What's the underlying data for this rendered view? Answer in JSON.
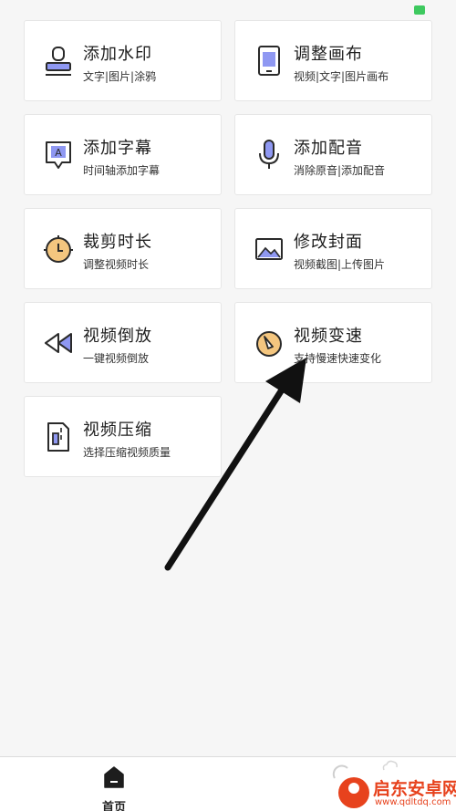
{
  "colors": {
    "accent_orange": "#f4c67f",
    "accent_purple": "#8f98f2",
    "icon_stroke": "#2a2a2a",
    "status_green": "#3ec95f",
    "watermark_red": "#e7421d"
  },
  "tools": [
    {
      "title": "添加水印",
      "subtitle": "文字|图片|涂鸦",
      "icon": "stamp-icon"
    },
    {
      "title": "调整画布",
      "subtitle": "视频|文字|图片画布",
      "icon": "tablet-icon"
    },
    {
      "title": "添加字幕",
      "subtitle": "时间轴添加字幕",
      "icon": "subtitle-icon"
    },
    {
      "title": "添加配音",
      "subtitle": "消除原音|添加配音",
      "icon": "microphone-icon"
    },
    {
      "title": "裁剪时长",
      "subtitle": "调整视频时长",
      "icon": "clock-icon"
    },
    {
      "title": "修改封面",
      "subtitle": "视频截图|上传图片",
      "icon": "image-icon"
    },
    {
      "title": "视频倒放",
      "subtitle": "一键视频倒放",
      "icon": "rewind-icon"
    },
    {
      "title": "视频变速",
      "subtitle": "支持慢速快速变化",
      "icon": "speed-dial-icon"
    },
    {
      "title": "视频压缩",
      "subtitle": "选择压缩视频质量",
      "icon": "compress-icon"
    }
  ],
  "tabbar": {
    "home_label": "首页"
  },
  "watermark": {
    "name": "启东安卓网",
    "url": "www.qdltdq.com"
  }
}
